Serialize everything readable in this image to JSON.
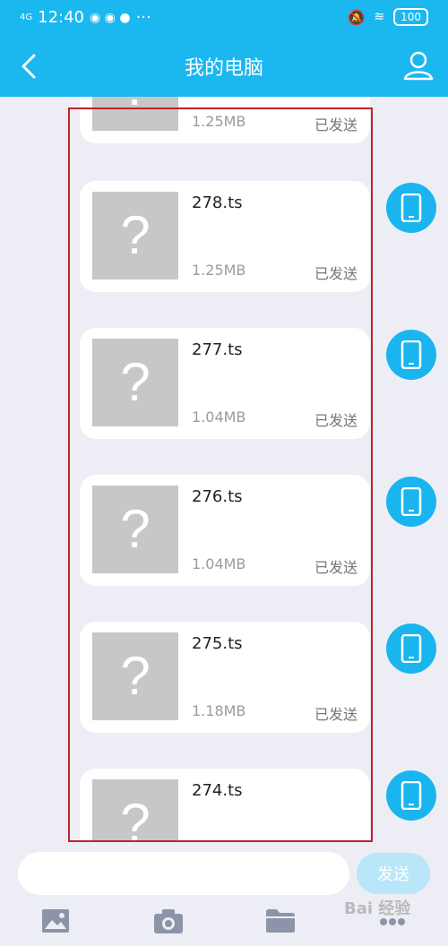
{
  "status_bar": {
    "network": "4G",
    "time": "12:40",
    "more": "···",
    "battery": "100"
  },
  "title_bar": {
    "title": "我的电脑"
  },
  "messages": [
    {
      "name": "",
      "size": "1.25MB",
      "status": "已发送"
    },
    {
      "name": "278.ts",
      "size": "1.25MB",
      "status": "已发送"
    },
    {
      "name": "277.ts",
      "size": "1.04MB",
      "status": "已发送"
    },
    {
      "name": "276.ts",
      "size": "1.04MB",
      "status": "已发送"
    },
    {
      "name": "275.ts",
      "size": "1.18MB",
      "status": "已发送"
    },
    {
      "name": "274.ts",
      "size": "",
      "status": ""
    }
  ],
  "thumbnail_glyph": "?",
  "composer": {
    "placeholder": "",
    "send_label": "发送"
  },
  "toolbar": {
    "items": [
      "image-icon",
      "camera-icon",
      "folder-icon",
      "more-icon"
    ]
  },
  "watermark": "Bai 经验",
  "colors": {
    "header": "#1bb7ef",
    "background": "#edeef5",
    "highlight": "#c3212c",
    "send_disabled": "#b9e6f8"
  }
}
